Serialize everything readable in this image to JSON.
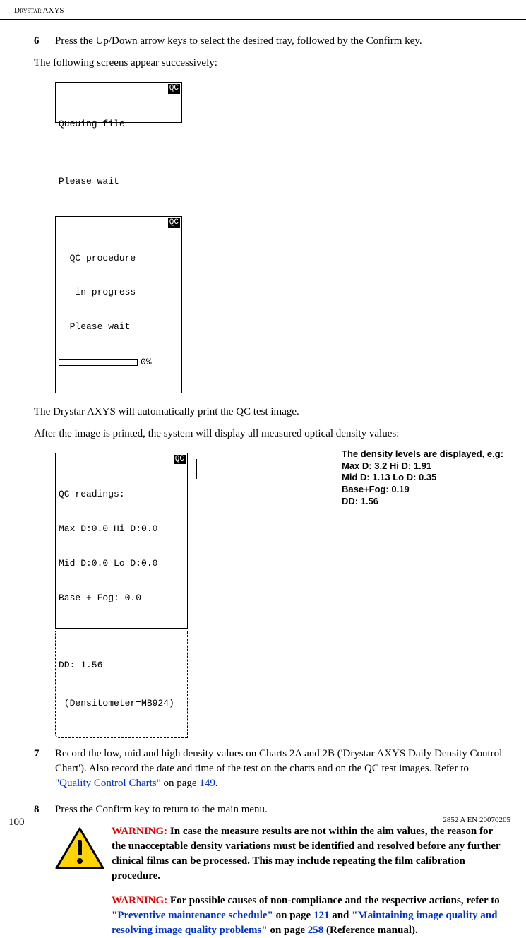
{
  "header": {
    "title": "Drystar AXYS"
  },
  "step6": {
    "num": "6",
    "text": "Press the Up/Down arrow keys to select the desired tray, followed by the Confirm key.",
    "followup": "The following screens appear successively:"
  },
  "lcd1": {
    "line1": "Queuing file",
    "line2": "",
    "line3": "Please wait",
    "tag": "QC"
  },
  "lcd2": {
    "line1": "  QC procedure",
    "line2": "   in progress",
    "line3": "  Please wait",
    "tag": "QC",
    "progress_label": "0%"
  },
  "after_lcd2_a": "The Drystar AXYS will automatically print the QC test image.",
  "after_lcd2_b": "After the image is printed, the system will display all measured optical density values:",
  "lcd3": {
    "line1": "QC readings:",
    "line2": "Max D:0.0 Hi D:0.0",
    "line3": "Mid D:0.0 Lo D:0.0",
    "line4": "Base + Fog: 0.0",
    "tag": "QC"
  },
  "dd_box": {
    "line1": "DD: 1.56",
    "line2": " (Densitometer=MB924)"
  },
  "density_callout": {
    "title": "The density levels are displayed, e.g:",
    "l1": "Max D: 3.2    Hi D: 1.91",
    "l2": "Mid D: 1.13    Lo D: 0.35",
    "l3": "Base+Fog: 0.19",
    "l4": "DD: 1.56"
  },
  "step7": {
    "num": "7",
    "text_a": "Record the low, mid and high density values on Charts 2A and 2B ('Drystar AXYS Daily Density Control Chart'). Also record the date and time of the test on the charts and on the QC test images. Refer to ",
    "link": "\"Quality Control Charts\"",
    "text_b": " on page ",
    "page": "149",
    "text_c": "."
  },
  "step8": {
    "num": "8",
    "text": "Press the Confirm key to return to the main menu."
  },
  "warning1": {
    "label": "WARNING:",
    "text": " In case the measure results are not within the aim values, the reason for the unacceptable density variations must be identified and resolved before any further clinical films can be processed. This may include repeating the film calibration procedure."
  },
  "warning2": {
    "label": "WARNING:",
    "text_a": " For possible causes of non-compliance and the respective actions, refer to ",
    "link1": "\"Preventive maintenance schedule\"",
    "text_b": " on page ",
    "page1": "121",
    "text_c": " and ",
    "link2": "\"Maintaining image quality and resolving image quality problems\"",
    "text_d": " on page ",
    "page2": "258",
    "text_e": " (Reference manual)."
  },
  "footer": {
    "page": "100",
    "docid": "2852 A EN 20070205"
  }
}
